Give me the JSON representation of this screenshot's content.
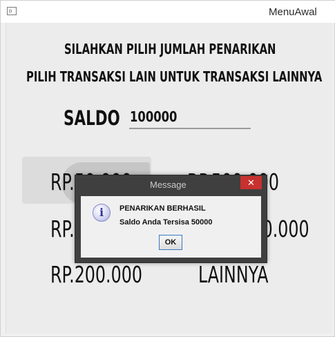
{
  "window": {
    "title": "MenuAwal"
  },
  "header": {
    "line1": "SILAHKAN PILIH JUMLAH PENARIKAN",
    "line2": "PILIH TRANSAKSI LAIN UNTUK TRANSAKSI LAINNYA"
  },
  "saldo": {
    "label": "SALDO",
    "value": "100000"
  },
  "options": {
    "opt1": "RP.50.000",
    "opt2": "RP.500.000",
    "opt3": "RP.100.000",
    "opt4": "RP.1.000.000",
    "opt5": "RP.200.000",
    "opt6": "LAINNYA"
  },
  "dialog": {
    "title": "Message",
    "close_glyph": "✕",
    "info_glyph": "i",
    "line1": "PENARIKAN BERHASIL",
    "line2": "Saldo Anda Tersisa 50000",
    "ok_label": "OK"
  }
}
